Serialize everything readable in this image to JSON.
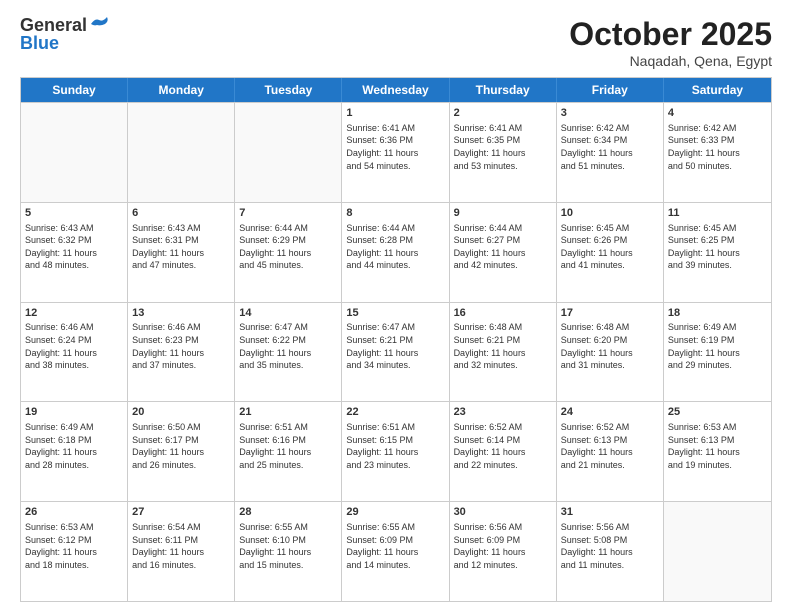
{
  "logo": {
    "line1": "General",
    "line2": "Blue"
  },
  "title": "October 2025",
  "subtitle": "Naqadah, Qena, Egypt",
  "weekdays": [
    "Sunday",
    "Monday",
    "Tuesday",
    "Wednesday",
    "Thursday",
    "Friday",
    "Saturday"
  ],
  "weeks": [
    [
      {
        "day": "",
        "info": ""
      },
      {
        "day": "",
        "info": ""
      },
      {
        "day": "",
        "info": ""
      },
      {
        "day": "1",
        "info": "Sunrise: 6:41 AM\nSunset: 6:36 PM\nDaylight: 11 hours\nand 54 minutes."
      },
      {
        "day": "2",
        "info": "Sunrise: 6:41 AM\nSunset: 6:35 PM\nDaylight: 11 hours\nand 53 minutes."
      },
      {
        "day": "3",
        "info": "Sunrise: 6:42 AM\nSunset: 6:34 PM\nDaylight: 11 hours\nand 51 minutes."
      },
      {
        "day": "4",
        "info": "Sunrise: 6:42 AM\nSunset: 6:33 PM\nDaylight: 11 hours\nand 50 minutes."
      }
    ],
    [
      {
        "day": "5",
        "info": "Sunrise: 6:43 AM\nSunset: 6:32 PM\nDaylight: 11 hours\nand 48 minutes."
      },
      {
        "day": "6",
        "info": "Sunrise: 6:43 AM\nSunset: 6:31 PM\nDaylight: 11 hours\nand 47 minutes."
      },
      {
        "day": "7",
        "info": "Sunrise: 6:44 AM\nSunset: 6:29 PM\nDaylight: 11 hours\nand 45 minutes."
      },
      {
        "day": "8",
        "info": "Sunrise: 6:44 AM\nSunset: 6:28 PM\nDaylight: 11 hours\nand 44 minutes."
      },
      {
        "day": "9",
        "info": "Sunrise: 6:44 AM\nSunset: 6:27 PM\nDaylight: 11 hours\nand 42 minutes."
      },
      {
        "day": "10",
        "info": "Sunrise: 6:45 AM\nSunset: 6:26 PM\nDaylight: 11 hours\nand 41 minutes."
      },
      {
        "day": "11",
        "info": "Sunrise: 6:45 AM\nSunset: 6:25 PM\nDaylight: 11 hours\nand 39 minutes."
      }
    ],
    [
      {
        "day": "12",
        "info": "Sunrise: 6:46 AM\nSunset: 6:24 PM\nDaylight: 11 hours\nand 38 minutes."
      },
      {
        "day": "13",
        "info": "Sunrise: 6:46 AM\nSunset: 6:23 PM\nDaylight: 11 hours\nand 37 minutes."
      },
      {
        "day": "14",
        "info": "Sunrise: 6:47 AM\nSunset: 6:22 PM\nDaylight: 11 hours\nand 35 minutes."
      },
      {
        "day": "15",
        "info": "Sunrise: 6:47 AM\nSunset: 6:21 PM\nDaylight: 11 hours\nand 34 minutes."
      },
      {
        "day": "16",
        "info": "Sunrise: 6:48 AM\nSunset: 6:21 PM\nDaylight: 11 hours\nand 32 minutes."
      },
      {
        "day": "17",
        "info": "Sunrise: 6:48 AM\nSunset: 6:20 PM\nDaylight: 11 hours\nand 31 minutes."
      },
      {
        "day": "18",
        "info": "Sunrise: 6:49 AM\nSunset: 6:19 PM\nDaylight: 11 hours\nand 29 minutes."
      }
    ],
    [
      {
        "day": "19",
        "info": "Sunrise: 6:49 AM\nSunset: 6:18 PM\nDaylight: 11 hours\nand 28 minutes."
      },
      {
        "day": "20",
        "info": "Sunrise: 6:50 AM\nSunset: 6:17 PM\nDaylight: 11 hours\nand 26 minutes."
      },
      {
        "day": "21",
        "info": "Sunrise: 6:51 AM\nSunset: 6:16 PM\nDaylight: 11 hours\nand 25 minutes."
      },
      {
        "day": "22",
        "info": "Sunrise: 6:51 AM\nSunset: 6:15 PM\nDaylight: 11 hours\nand 23 minutes."
      },
      {
        "day": "23",
        "info": "Sunrise: 6:52 AM\nSunset: 6:14 PM\nDaylight: 11 hours\nand 22 minutes."
      },
      {
        "day": "24",
        "info": "Sunrise: 6:52 AM\nSunset: 6:13 PM\nDaylight: 11 hours\nand 21 minutes."
      },
      {
        "day": "25",
        "info": "Sunrise: 6:53 AM\nSunset: 6:13 PM\nDaylight: 11 hours\nand 19 minutes."
      }
    ],
    [
      {
        "day": "26",
        "info": "Sunrise: 6:53 AM\nSunset: 6:12 PM\nDaylight: 11 hours\nand 18 minutes."
      },
      {
        "day": "27",
        "info": "Sunrise: 6:54 AM\nSunset: 6:11 PM\nDaylight: 11 hours\nand 16 minutes."
      },
      {
        "day": "28",
        "info": "Sunrise: 6:55 AM\nSunset: 6:10 PM\nDaylight: 11 hours\nand 15 minutes."
      },
      {
        "day": "29",
        "info": "Sunrise: 6:55 AM\nSunset: 6:09 PM\nDaylight: 11 hours\nand 14 minutes."
      },
      {
        "day": "30",
        "info": "Sunrise: 6:56 AM\nSunset: 6:09 PM\nDaylight: 11 hours\nand 12 minutes."
      },
      {
        "day": "31",
        "info": "Sunrise: 5:56 AM\nSunset: 5:08 PM\nDaylight: 11 hours\nand 11 minutes."
      },
      {
        "day": "",
        "info": ""
      }
    ]
  ]
}
